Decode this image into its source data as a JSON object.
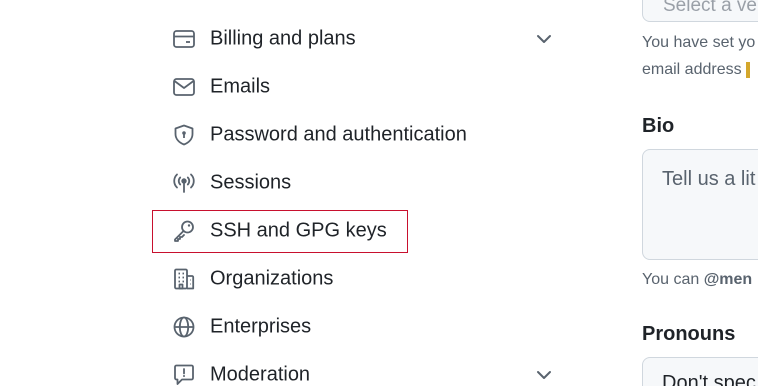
{
  "sidebar": {
    "items": [
      {
        "label": "Billing and plans",
        "icon": "credit-card-icon",
        "has_chevron": true
      },
      {
        "label": "Emails",
        "icon": "mail-icon",
        "has_chevron": false
      },
      {
        "label": "Password and authentication",
        "icon": "shield-lock-icon",
        "has_chevron": false
      },
      {
        "label": "Sessions",
        "icon": "broadcast-icon",
        "has_chevron": false
      },
      {
        "label": "SSH and GPG keys",
        "icon": "key-icon",
        "has_chevron": false,
        "highlighted": true
      },
      {
        "label": "Organizations",
        "icon": "organization-icon",
        "has_chevron": false
      },
      {
        "label": "Enterprises",
        "icon": "globe-icon",
        "has_chevron": false
      },
      {
        "label": "Moderation",
        "icon": "report-icon",
        "has_chevron": true
      }
    ],
    "highlight_color": "#c8102e"
  },
  "form": {
    "email_select_text": "Select a ve",
    "email_hint_line1": "You have set yo",
    "email_hint_line2": "email address ",
    "bio_label": "Bio",
    "bio_placeholder": "Tell us a lit",
    "bio_hint_prefix": "You can ",
    "bio_hint_mention": "@men",
    "pronouns_label": "Pronouns",
    "pronouns_value": "Don't spec"
  }
}
